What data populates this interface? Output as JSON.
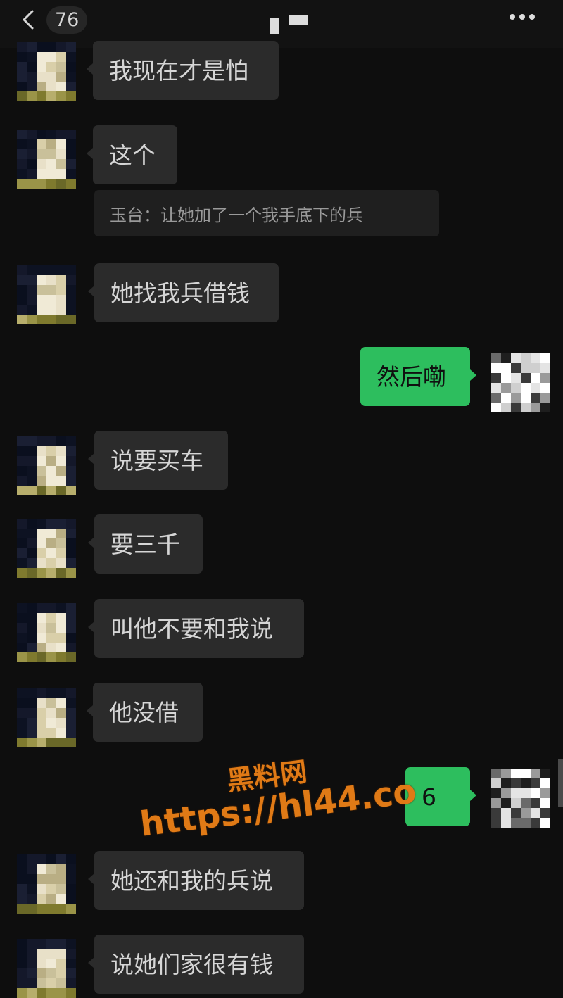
{
  "header": {
    "unread_count": "76"
  },
  "messages": [
    {
      "side": "in",
      "text": "我现在才是怕"
    },
    {
      "side": "in",
      "text": "这个"
    },
    {
      "side": "quote",
      "text": "玉台：让她加了一个我手底下的兵"
    },
    {
      "side": "in",
      "text": "她找我兵借钱"
    },
    {
      "side": "out",
      "text": "然后嘞"
    },
    {
      "side": "in",
      "text": "说要买车"
    },
    {
      "side": "in",
      "text": "要三千"
    },
    {
      "side": "in",
      "text": "叫他不要和我说"
    },
    {
      "side": "in",
      "text": "他没借"
    },
    {
      "side": "out",
      "text": "6"
    },
    {
      "side": "in",
      "text": "她还和我的兵说"
    },
    {
      "side": "in",
      "text": "说她们家很有钱"
    }
  ],
  "watermark": {
    "line1": "黑料网",
    "line2": "https://hl44.co"
  },
  "colors": {
    "background": "#0e0e0e",
    "incoming_bubble": "#2b2b2b",
    "outgoing_bubble": "#2dbe5e",
    "watermark": "#e07a16"
  },
  "icons": {
    "back": "chevron-left-icon",
    "more": "more-dots-icon"
  }
}
